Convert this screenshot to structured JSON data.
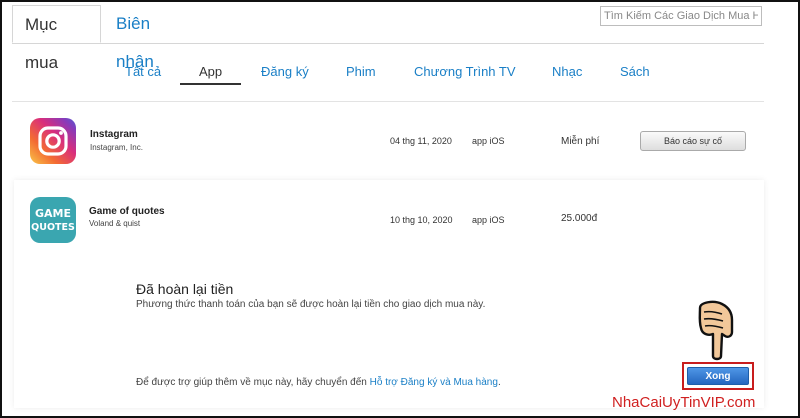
{
  "tabs": [
    {
      "label": "Mục mua",
      "active": true
    },
    {
      "label": "Biên nhận",
      "active": false
    }
  ],
  "search": {
    "placeholder": "Tìm Kiếm Các Giao Dịch Mua H"
  },
  "categories": [
    {
      "label": "Tất cả"
    },
    {
      "label": "App",
      "active": true
    },
    {
      "label": "Đăng ký"
    },
    {
      "label": "Phim"
    },
    {
      "label": "Chương Trình TV"
    },
    {
      "label": "Nhạc"
    },
    {
      "label": "Sách"
    }
  ],
  "purchases": [
    {
      "name": "Instagram",
      "developer": "Instagram, Inc.",
      "date": "04 thg 11, 2020",
      "type": "app iOS",
      "price": "Miễn phí",
      "action_label": "Báo cáo sự cố",
      "icon": "instagram-icon"
    },
    {
      "name": "Game of quotes",
      "developer": "Voland & quist",
      "date": "10 thg 10, 2020",
      "type": "app iOS",
      "price": "25.000đ",
      "icon": "game-of-quotes-icon",
      "icon_text_1": "GAME",
      "icon_text_2": "QUOTES"
    }
  ],
  "refund": {
    "title": "Đã hoàn lại tiền",
    "message": "Phương thức thanh toán của bạn sẽ được hoàn lại tiền cho giao dịch mua này.",
    "help_prefix": "Để được trợ giúp thêm về mục này, hãy chuyển đến ",
    "help_link": "Hỗ trợ Đăng ký và Mua hàng",
    "help_suffix": ".",
    "done_label": "Xong"
  },
  "watermark": "NhaCaiUyTinVIP.com",
  "colors": {
    "link": "#1a7fc6",
    "done_button": "#2e74cf",
    "highlight_border": "#c81d1d",
    "watermark": "#d02020"
  }
}
